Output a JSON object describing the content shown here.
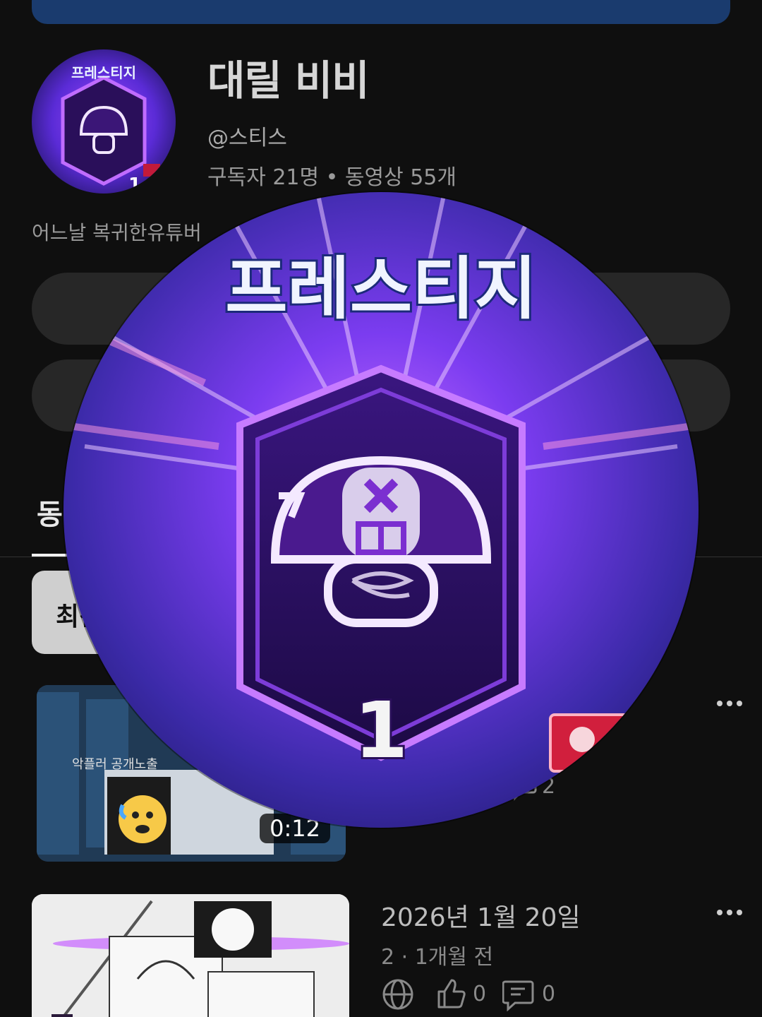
{
  "channel": {
    "name": "대릴 비비",
    "handle": "@스티스",
    "stats": "구독자 21명 • 동영상 55개",
    "description": "어느날 복귀한유튜버"
  },
  "avatar": {
    "banner_text": "프레스티지",
    "prestige_level": "1"
  },
  "tabs": {
    "videos_partial": "동"
  },
  "filter_chip": {
    "latest_partial": "최신"
  },
  "videos": [
    {
      "thumb_text": "악플러 공개노출",
      "duration": "0:12",
      "comments": "2"
    },
    {
      "date": "2026년 1월 20일",
      "meta": "2 · 1개월 전",
      "likes": "0",
      "comments": "0"
    }
  ],
  "colors": {
    "background": "#0f0f0f",
    "pill": "#272727",
    "accent_purple": "#8a3cff",
    "banner_blue": "#1a3b6e"
  }
}
